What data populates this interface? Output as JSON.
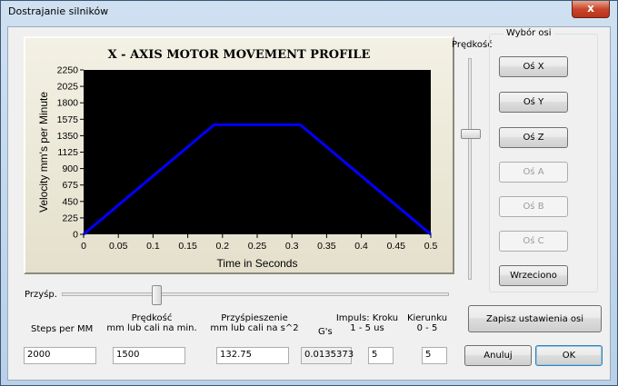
{
  "window": {
    "title": "Dostrajanie silników",
    "close_label": "x"
  },
  "chart_data": {
    "type": "line",
    "title": "X - AXIS MOTOR MOVEMENT PROFILE",
    "xlabel": "Time in Seconds",
    "ylabel": "Velocity mm's per Minute",
    "xlim": [
      0,
      0.5
    ],
    "ylim": [
      0,
      2250
    ],
    "x_ticks": [
      "0",
      "0.05",
      "0.1",
      "0.15",
      "0.2",
      "0.25",
      "0.3",
      "0.35",
      "0.4",
      "0.45",
      "0.5"
    ],
    "y_ticks": [
      "0",
      "225",
      "450",
      "675",
      "900",
      "1125",
      "1350",
      "1575",
      "1800",
      "2025",
      "2250"
    ],
    "background": "#000000",
    "series": [
      {
        "color": "#0000ff",
        "x": [
          0,
          0.188,
          0.312,
          0.5
        ],
        "y": [
          0,
          1500,
          1500,
          0
        ]
      }
    ]
  },
  "speed_slider": {
    "label": "Prędkość",
    "value_percent": 65
  },
  "accel_slider": {
    "label": "Przyśp.",
    "value_percent": 25
  },
  "axis_group": {
    "title": "Wybór osi",
    "buttons": [
      {
        "label": "Oś X",
        "enabled": true
      },
      {
        "label": "Oś Y",
        "enabled": true
      },
      {
        "label": "Oś Z",
        "enabled": true
      },
      {
        "label": "Oś A",
        "enabled": false
      },
      {
        "label": "Oś B",
        "enabled": false
      },
      {
        "label": "Oś C",
        "enabled": false
      },
      {
        "label": "Wrzeciono",
        "enabled": true
      }
    ]
  },
  "fields": {
    "steps": {
      "label": "Steps per MM",
      "value": "2000"
    },
    "velocity": {
      "label_line1": "Prędkość",
      "label_line2": "mm lub cali na min.",
      "value": "1500"
    },
    "accel": {
      "label_line1": "Przyśpieszenie",
      "label_line2": "mm lub cali na s^2",
      "value": "132.75"
    },
    "gs": {
      "label": "G's",
      "value": "0.0135373"
    },
    "step_pulse": {
      "label_line1": "Impuls:  Kroku",
      "label_line2": "1 - 5 us",
      "value": "5"
    },
    "dir_pulse": {
      "label_line1": "Kierunku",
      "label_line2": "0 - 5",
      "value": "5"
    }
  },
  "buttons": {
    "save": "Zapisz ustawienia osi",
    "cancel": "Anuluj",
    "ok": "OK"
  }
}
